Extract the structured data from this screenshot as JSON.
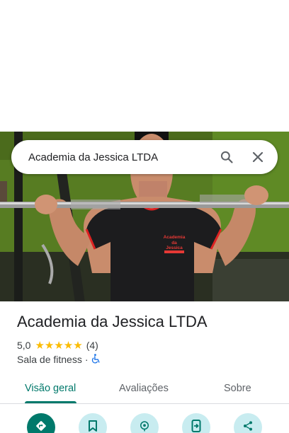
{
  "search": {
    "query": "Academia da Jessica LTDA",
    "search_icon": "search-icon",
    "close_icon": "close-icon"
  },
  "hero": {
    "shirt_print": [
      "Academia",
      "da",
      "Jessica"
    ]
  },
  "place": {
    "title": "Academia da Jessica LTDA",
    "rating": "5,0",
    "stars": "★★★★★",
    "review_count": "(4)",
    "category": "Sala de fitness",
    "separator": "·",
    "accessibility_icon": "wheelchair-icon"
  },
  "tabs": [
    {
      "label": "Visão geral",
      "active": true
    },
    {
      "label": "Avaliações",
      "active": false
    },
    {
      "label": "Sobre",
      "active": false
    }
  ],
  "actions": [
    {
      "icon": "directions-icon"
    },
    {
      "icon": "bookmark-icon"
    },
    {
      "icon": "nearby-icon"
    },
    {
      "icon": "send-to-phone-icon"
    },
    {
      "icon": "share-icon"
    }
  ],
  "colors": {
    "accent": "#00796b",
    "star": "#fbbc04",
    "action_bg": "#c8ecf0",
    "accessibility": "#1a73e8"
  }
}
